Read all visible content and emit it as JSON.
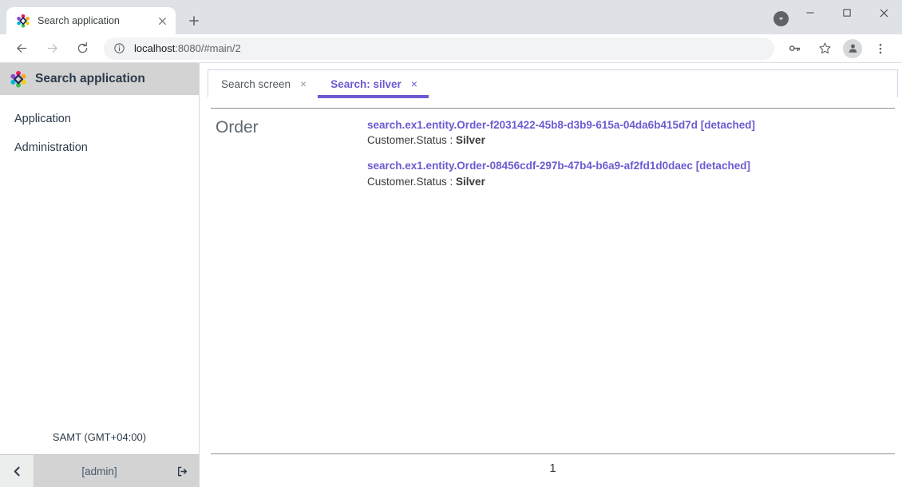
{
  "browser": {
    "tab": {
      "title": "Search application",
      "favicon_icon": "app-diamond-favicon",
      "close_icon": "close-icon"
    },
    "new_tab_icon": "plus-icon",
    "window": {
      "chevron_icon": "chevron-down-icon",
      "minimize_icon": "minimize-icon",
      "maximize_icon": "maximize-icon",
      "close_icon": "close-icon"
    },
    "toolbar": {
      "back_icon": "arrow-left-icon",
      "forward_icon": "arrow-right-icon",
      "reload_icon": "reload-icon",
      "site_info_icon": "info-circle-icon",
      "url_host": "localhost",
      "url_rest": ":8080/#main/2",
      "url_full": "localhost:8080/#main/2",
      "password_icon": "key-icon",
      "bookmark_icon": "star-icon",
      "profile_icon": "account-avatar-icon",
      "menu_icon": "three-dots-menu-icon"
    }
  },
  "sidebar": {
    "logo_icon": "app-diamond-logo",
    "title": "Search application",
    "items": [
      {
        "label": "Application"
      },
      {
        "label": "Administration"
      }
    ],
    "timezone": "SAMT (GMT+04:00)",
    "collapse_icon": "chevron-left-icon",
    "user": "[admin]",
    "logout_icon": "logout-icon"
  },
  "main": {
    "tabs": [
      {
        "label": "Search screen",
        "close": "×",
        "active": false
      },
      {
        "label": "Search: silver",
        "close": "×",
        "active": true
      }
    ],
    "results": [
      {
        "entity": "Order",
        "hits": [
          {
            "link": "search.ex1.entity.Order-f2031422-45b8-d3b9-615a-04da6b415d7d [detached]",
            "field_label": "Customer.Status : ",
            "field_value": "Silver"
          },
          {
            "link": "search.ex1.entity.Order-08456cdf-297b-47b4-b6a9-af2fd1d0daec [detached]",
            "field_label": "Customer.Status : ",
            "field_value": "Silver"
          }
        ]
      }
    ],
    "pagination": {
      "current_page": "1"
    }
  },
  "colors": {
    "accent_purple": "#6a5bd1",
    "sidebar_header": "#d3d3d3",
    "chrome_titlebar": "#dee1e6"
  }
}
